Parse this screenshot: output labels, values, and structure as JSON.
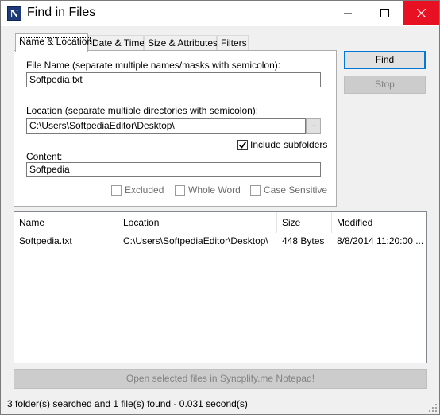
{
  "window": {
    "title": "Find in Files",
    "app_icon_letter": "N"
  },
  "tabs": [
    {
      "label": "Name & Location",
      "active": true
    },
    {
      "label": "Date & Time",
      "active": false
    },
    {
      "label": "Size & Attributes",
      "active": false
    },
    {
      "label": "Filters",
      "active": false
    }
  ],
  "form": {
    "file_name_label": "File Name (separate multiple names/masks with semicolon):",
    "file_name_value": "Softpedia.txt",
    "location_label": "Location (separate multiple directories with semicolon):",
    "location_value": "C:\\Users\\SoftpediaEditor\\Desktop\\",
    "browse_label": "...",
    "include_subfolders_label": "Include subfolders",
    "include_subfolders_checked": true,
    "content_label": "Content:",
    "content_value": "Softpedia",
    "excluded_label": "Excluded",
    "whole_word_label": "Whole Word",
    "case_sensitive_label": "Case Sensitive"
  },
  "buttons": {
    "find_label": "Find",
    "stop_label": "Stop",
    "open_label": "Open selected files in Syncplify.me Notepad!"
  },
  "results": {
    "columns": [
      "Name",
      "Location",
      "Size",
      "Modified"
    ],
    "rows": [
      [
        "Softpedia.txt",
        "C:\\Users\\SoftpediaEditor\\Desktop\\",
        "448 Bytes",
        "8/8/2014 11:20:00 ..."
      ]
    ]
  },
  "status": {
    "text": "3 folder(s) searched and 1 file(s) found - 0.031 second(s)"
  },
  "colors": {
    "accent": "#0078d7",
    "close_hover": "#e81123",
    "app_icon_bg": "#1e3a78"
  }
}
